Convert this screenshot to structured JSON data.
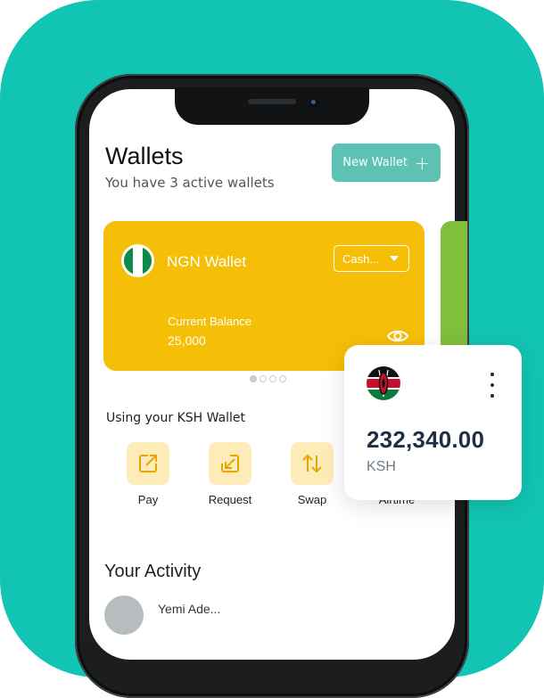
{
  "header": {
    "title": "Wallets",
    "subtitle": "You have 3 active wallets",
    "new_wallet_label": "New Wallet"
  },
  "wallet_card": {
    "name": "NGN Wallet",
    "currency_select_value": "Cash...",
    "balance_label": "Current Balance",
    "balance_value": "25,000",
    "color": "#f5be07"
  },
  "carousel": {
    "total": 4,
    "active_index": 0
  },
  "actions": {
    "section_title": "Using your KSH Wallet",
    "items": [
      {
        "label": "Pay",
        "icon": "arrow-up-right-icon"
      },
      {
        "label": "Request",
        "icon": "arrow-down-left-icon"
      },
      {
        "label": "Swap",
        "icon": "swap-icon"
      },
      {
        "label": "Airtime",
        "icon": "airtime-icon"
      }
    ]
  },
  "activity": {
    "title": "Your Activity",
    "first_item_name": "Yemi Ade..."
  },
  "popup": {
    "amount": "232,340.00",
    "currency": "KSH"
  },
  "colors": {
    "background": "#12c4b3",
    "accent": "#5dc2b3",
    "action_bg": "#fdebb8",
    "action_icon": "#e8a400"
  }
}
